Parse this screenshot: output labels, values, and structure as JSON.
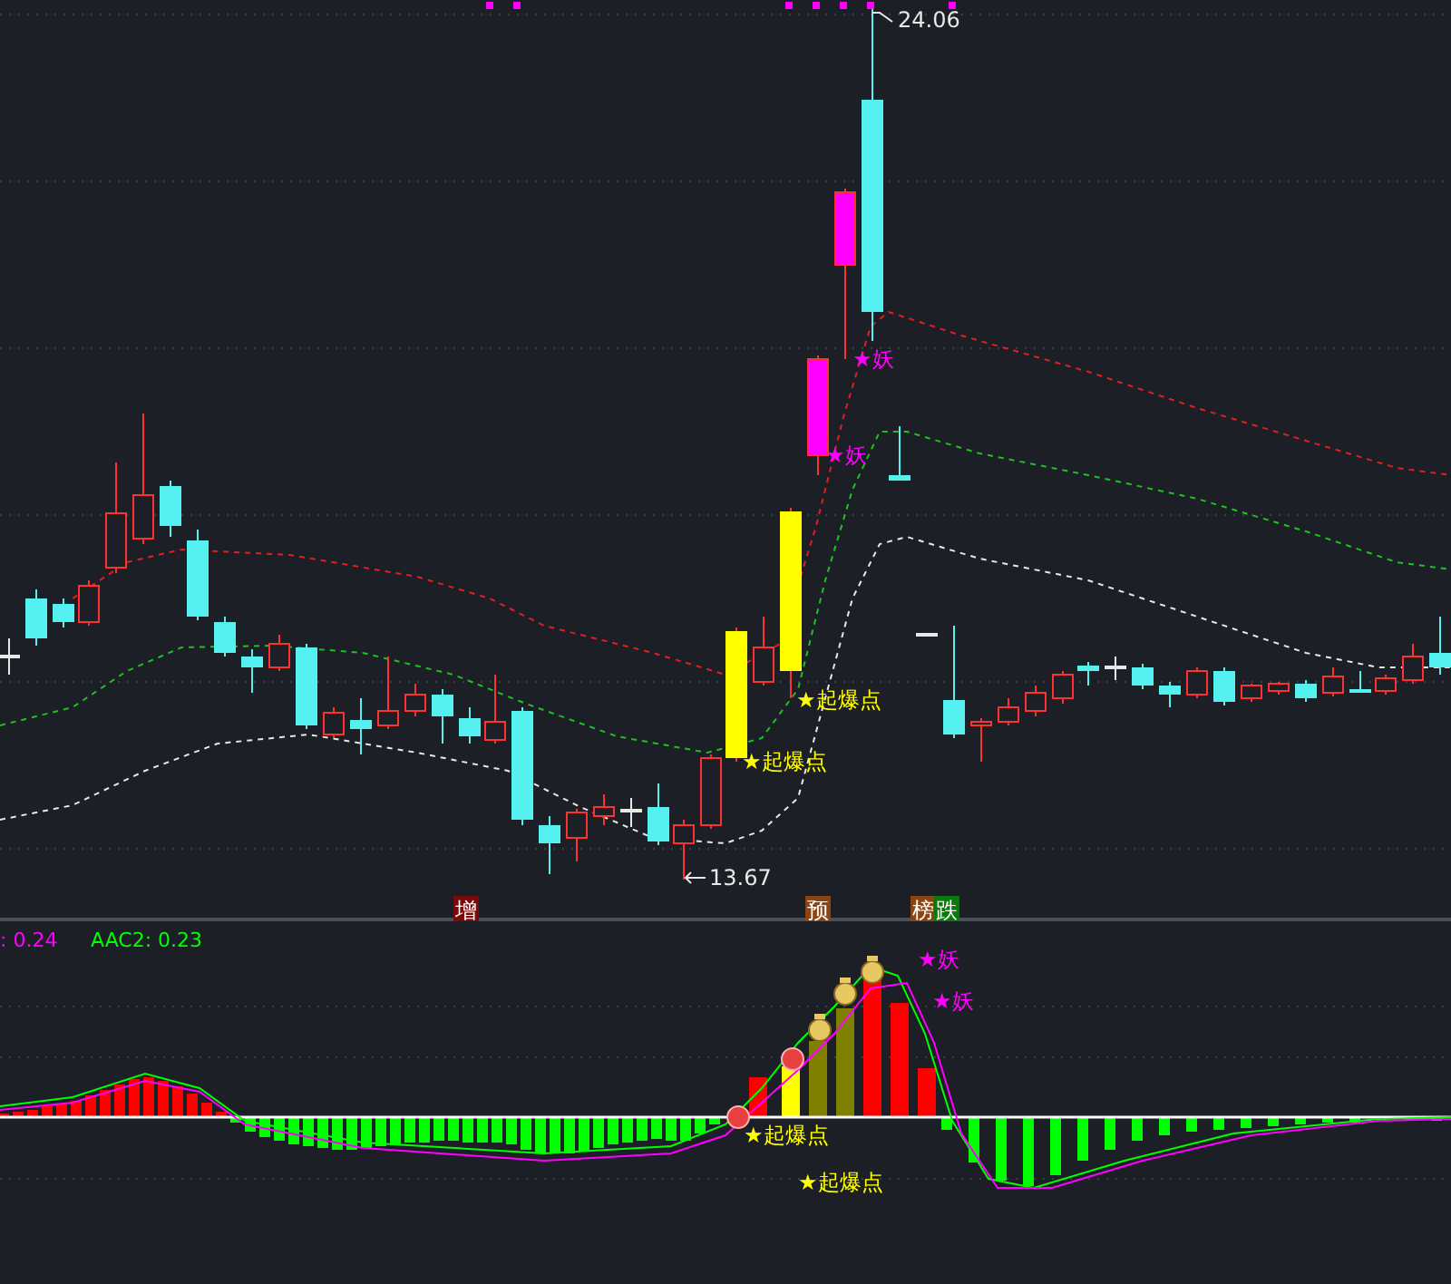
{
  "price_chart": {
    "high_label": "24.06",
    "low_label": "13.67",
    "signals": [
      {
        "kind": "yao",
        "text": "★妖"
      },
      {
        "kind": "yao",
        "text": "★妖"
      },
      {
        "kind": "burst",
        "text": "★起爆点"
      },
      {
        "kind": "burst",
        "text": "★起爆点"
      }
    ],
    "tags": [
      {
        "text": "增",
        "color": "#7a0a0a"
      },
      {
        "text": "预",
        "color": "#8b4513"
      },
      {
        "text": "榜",
        "color": "#8b4513"
      },
      {
        "text": "跌",
        "color": "#0a7a0a"
      }
    ]
  },
  "indicator": {
    "readouts": [
      {
        "text": ": 0.24",
        "color": "#ff00ff"
      },
      {
        "text": "AAC2: 0.23",
        "color": "#00ff00"
      }
    ],
    "signals": [
      {
        "kind": "yao",
        "text": "★妖"
      },
      {
        "kind": "yao",
        "text": "★妖"
      },
      {
        "kind": "burst",
        "text": "★起爆点"
      },
      {
        "kind": "burst",
        "text": "★起爆点"
      }
    ]
  }
}
